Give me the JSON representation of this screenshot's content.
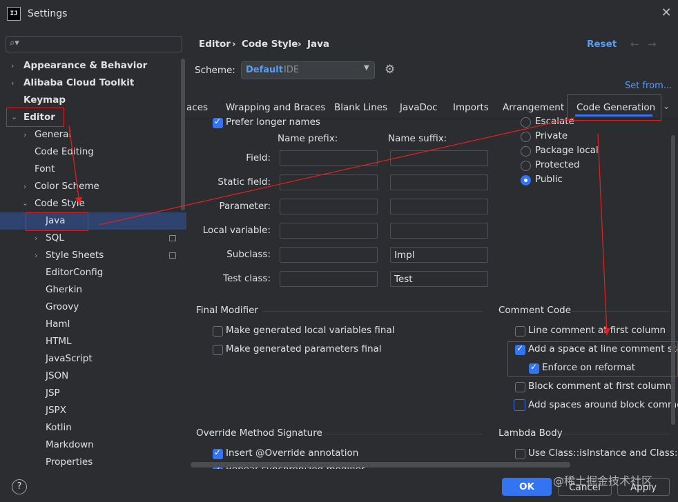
{
  "window": {
    "title": "Settings",
    "app_icon_text": "IJ"
  },
  "search": {
    "placeholder": ""
  },
  "sidebar": {
    "items": [
      {
        "label": "Appearance & Behavior"
      },
      {
        "label": "Alibaba Cloud Toolkit"
      },
      {
        "label": "Keymap"
      },
      {
        "label": "Editor"
      },
      {
        "label": "General"
      },
      {
        "label": "Code Editing"
      },
      {
        "label": "Font"
      },
      {
        "label": "Color Scheme"
      },
      {
        "label": "Code Style"
      },
      {
        "label": "Java"
      },
      {
        "label": "SQL"
      },
      {
        "label": "Style Sheets"
      },
      {
        "label": "EditorConfig"
      },
      {
        "label": "Gherkin"
      },
      {
        "label": "Groovy"
      },
      {
        "label": "Haml"
      },
      {
        "label": "HTML"
      },
      {
        "label": "JavaScript"
      },
      {
        "label": "JSON"
      },
      {
        "label": "JSP"
      },
      {
        "label": "JSPX"
      },
      {
        "label": "Kotlin"
      },
      {
        "label": "Markdown"
      },
      {
        "label": "Properties"
      }
    ]
  },
  "breadcrumb": {
    "items": [
      "Editor",
      "Code Style",
      "Java"
    ],
    "separator": "›"
  },
  "header": {
    "reset_label": "Reset",
    "back_arrow": "←",
    "forward_arrow": "→"
  },
  "scheme": {
    "label": "Scheme:",
    "value": "Default",
    "suffix": "IDE"
  },
  "set_from": "Set from...",
  "tabs": [
    {
      "label": "aces"
    },
    {
      "label": "Wrapping and Braces"
    },
    {
      "label": "Blank Lines"
    },
    {
      "label": "JavaDoc"
    },
    {
      "label": "Imports"
    },
    {
      "label": "Arrangement"
    },
    {
      "label": "Code Generation",
      "active": true
    }
  ],
  "naming": {
    "prefer_longer_names": "Prefer longer names",
    "prefix_header": "Name prefix:",
    "suffix_header": "Name suffix:",
    "rows": [
      {
        "label": "Field:",
        "prefix": "",
        "suffix": ""
      },
      {
        "label": "Static field:",
        "prefix": "",
        "suffix": ""
      },
      {
        "label": "Parameter:",
        "prefix": "",
        "suffix": ""
      },
      {
        "label": "Local variable:",
        "prefix": "",
        "suffix": ""
      },
      {
        "label": "Subclass:",
        "prefix": "",
        "suffix": "Impl"
      },
      {
        "label": "Test class:",
        "prefix": "",
        "suffix": "Test"
      }
    ]
  },
  "visibility": {
    "options": [
      "Escalate",
      "Private",
      "Package local",
      "Protected",
      "Public"
    ],
    "selected": "Public"
  },
  "final_modifier": {
    "title": "Final Modifier",
    "options": [
      {
        "label": "Make generated local variables final",
        "checked": false
      },
      {
        "label": "Make generated parameters final",
        "checked": false
      }
    ]
  },
  "comment_code": {
    "title": "Comment Code",
    "options": [
      {
        "label": "Line comment at first column",
        "checked": false
      },
      {
        "label": "Add a space at line comment start",
        "checked": true
      },
      {
        "label": "Enforce on reformat",
        "checked": true
      },
      {
        "label": "Block comment at first column",
        "checked": false
      },
      {
        "label": "Add spaces around block commen",
        "checked": false
      }
    ]
  },
  "override": {
    "title": "Override Method Signature",
    "options": [
      {
        "label": "Insert @Override annotation",
        "checked": true
      },
      {
        "label": "Repeat synchronized modifier",
        "checked": true
      }
    ]
  },
  "lambda": {
    "title": "Lambda Body",
    "options": [
      {
        "label": "Use Class::isInstance and Class::ca",
        "checked": false
      }
    ]
  },
  "footer": {
    "help": "?",
    "ok": "OK",
    "cancel": "Cancel",
    "apply": "Apply"
  },
  "watermark": "@稀土掘金技术社区",
  "colors": {
    "accent": "#3574f0",
    "link": "#589df6",
    "annotation": "#e02020",
    "selection": "#2e436e"
  }
}
